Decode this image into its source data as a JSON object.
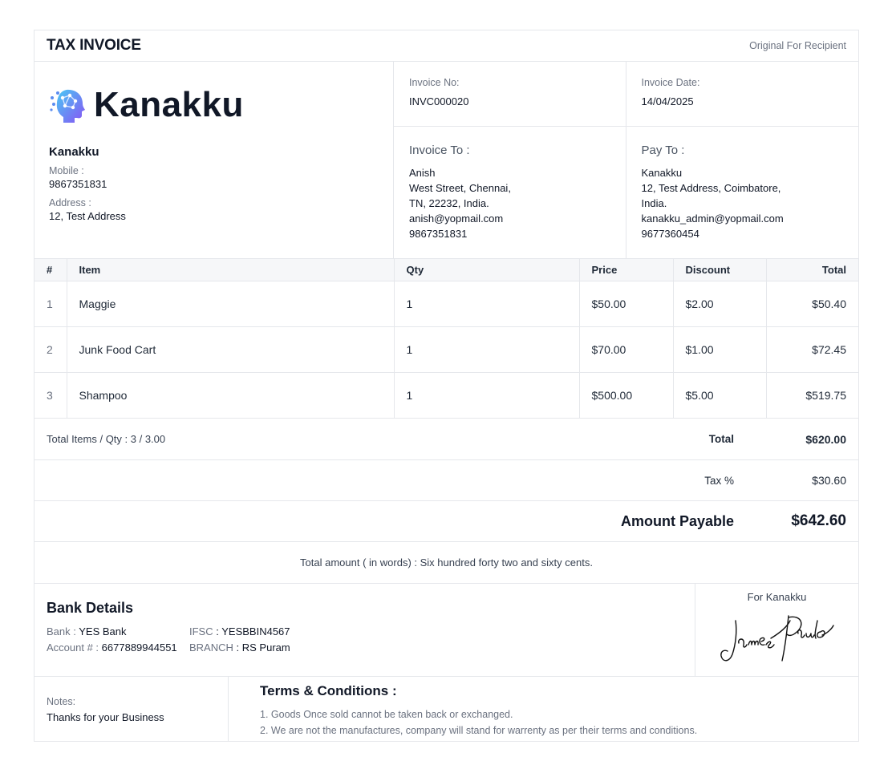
{
  "header": {
    "title": "TAX INVOICE",
    "copy_label": "Original For Recipient"
  },
  "brand": {
    "logo_text": "Kanakku",
    "logo_icon": "ai-head-icon",
    "accent": "#6d4cf5"
  },
  "seller": {
    "name": "Kanakku",
    "mobile_label": "Mobile :",
    "mobile": "9867351831",
    "address_label": "Address :",
    "address": "12, Test Address"
  },
  "invoice": {
    "no_label": "Invoice No:",
    "no": "INVC000020",
    "date_label": "Invoice Date:",
    "date": "14/04/2025"
  },
  "invoice_to": {
    "title": "Invoice To :",
    "lines": [
      "Anish",
      "West Street, Chennai,",
      "TN, 22232, India.",
      "anish@yopmail.com",
      "9867351831"
    ]
  },
  "pay_to": {
    "title": "Pay To :",
    "lines": [
      "Kanakku",
      "12, Test Address, Coimbatore,",
      "India.",
      "kanakku_admin@yopmail.com",
      "9677360454"
    ]
  },
  "table": {
    "headers": [
      "#",
      "Item",
      "Qty",
      "Price",
      "Discount",
      "Total"
    ],
    "rows": [
      [
        "1",
        "Maggie",
        "1",
        "$50.00",
        "$2.00",
        "$50.40"
      ],
      [
        "2",
        "Junk Food Cart",
        "1",
        "$70.00",
        "$1.00",
        "$72.45"
      ],
      [
        "3",
        "Shampoo",
        "1",
        "$500.00",
        "$5.00",
        "$519.75"
      ]
    ]
  },
  "summary": {
    "items_qty": "Total Items / Qty : 3 / 3.00",
    "total_label": "Total",
    "total": "$620.00",
    "tax_label": "Tax %",
    "tax": "$30.60",
    "payable_label": "Amount Payable",
    "payable": "$642.60",
    "in_words": "Total amount ( in words) : Six hundred forty two and sixty cents."
  },
  "bank": {
    "title": "Bank Details",
    "bank_label": "Bank :",
    "bank": "YES Bank",
    "ifsc_label": "IFSC",
    "ifsc": ": YESBBIN4567",
    "account_label": "Account # :",
    "account": "6677889944551",
    "branch_label": "BRANCH",
    "branch": ": RS Puram"
  },
  "signature": {
    "for_label": "For Kanakku",
    "name": "James Paulo"
  },
  "notes": {
    "label": "Notes:",
    "text": "Thanks for your Business"
  },
  "terms": {
    "title": "Terms & Conditions :",
    "items": [
      "1. Goods Once sold cannot be taken back or exchanged.",
      "2. We are not the manufactures, company will stand for warrenty as per their terms and conditions."
    ]
  }
}
